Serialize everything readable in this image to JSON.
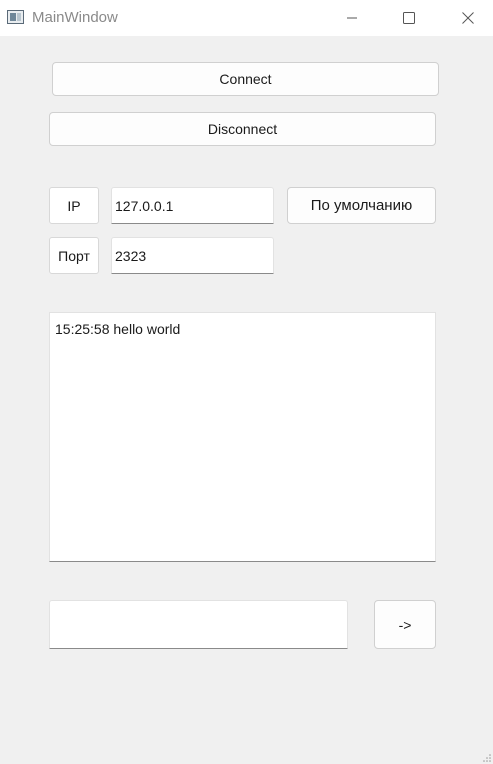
{
  "window": {
    "title": "MainWindow",
    "controls": {
      "minimize_icon": "minimize-icon",
      "maximize_icon": "maximize-icon",
      "close_icon": "close-icon"
    }
  },
  "connection": {
    "connect_label": "Connect",
    "disconnect_label": "Disconnect"
  },
  "settings": {
    "ip_label": "IP",
    "ip_value": "127.0.0.1",
    "port_label": "Порт",
    "port_value": "2323",
    "default_button_label": "По умолчанию"
  },
  "log": {
    "text": "15:25:58 hello world"
  },
  "message": {
    "input_value": "",
    "send_label": "->"
  },
  "colors": {
    "window_bg": "#f0f0f0",
    "titlebar_bg": "#ffffff",
    "button_bg": "#fdfdfd"
  }
}
